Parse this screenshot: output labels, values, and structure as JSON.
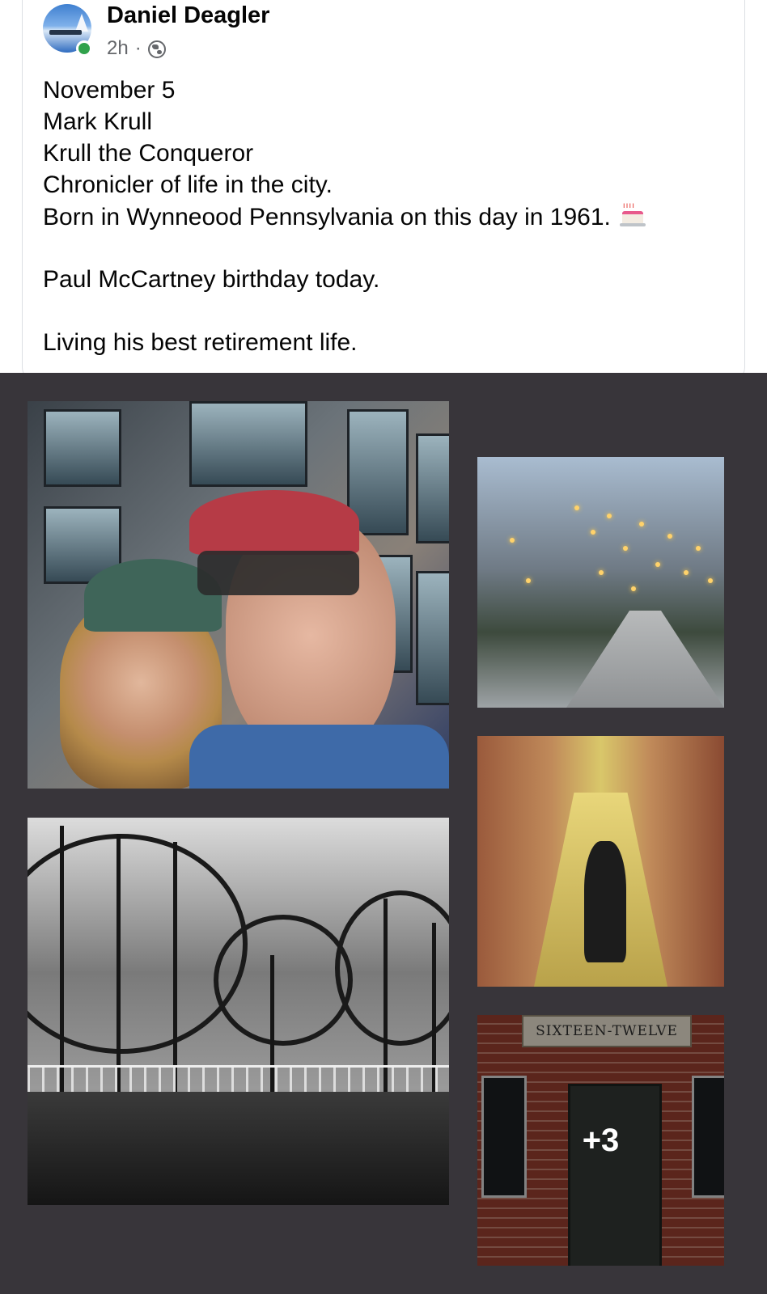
{
  "post": {
    "author": "Daniel Deagler",
    "time": "2h",
    "separator": "·",
    "privacy_icon": "globe-icon",
    "lines": [
      "November 5",
      "Mark Krull",
      "Krull the Conqueror",
      "Chronicler of life in the city.",
      "Born in Wynneood Pennsylvania on this day in 1961."
    ],
    "emoji": "birthday-cake-icon",
    "line_mccartney": "Paul McCartney birthday today.",
    "line_retirement": "Living his best retirement life."
  },
  "gallery": {
    "sign_text": "SIXTEEN-TWELVE",
    "more_count": "+3"
  },
  "colors": {
    "gallery_bg": "#38353a",
    "online_dot": "#31a24c"
  }
}
